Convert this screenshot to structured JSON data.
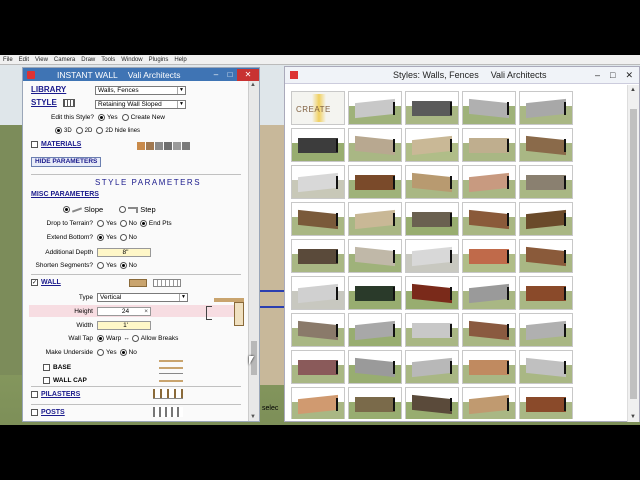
{
  "app_menu": [
    "File",
    "Edit",
    "View",
    "Camera",
    "Draw",
    "Tools",
    "Window",
    "Plugins",
    "Help"
  ],
  "scene": {
    "select_text": "selec"
  },
  "instant_wall": {
    "title": "INSTANT WALL",
    "subtitle": "Vali Architects",
    "library_label": "LIBRARY",
    "library_value": "Walls, Fences",
    "style_label": "STYLE",
    "style_value": "Retaining Wall Sloped",
    "edit_style_label": "Edit this Style?",
    "yes": "Yes",
    "create_new": "Create New",
    "view_3d": "3D",
    "view_2d": "2D",
    "view_2d_hide": "2D hide lines",
    "materials_label": "MATERIALS",
    "hide_params_button": "HIDE PARAMETERS",
    "style_params_title": "STYLE PARAMETERS",
    "misc_params_label": "MISC PARAMETERS",
    "slope": "Slope",
    "step": "Step",
    "drop_to_terrain_label": "Drop to Terrain?",
    "no": "No",
    "end_pts": "End Pts",
    "extend_bottom_label": "Extend Bottom?",
    "additional_depth_label": "Additional Depth",
    "additional_depth_value": "8\"",
    "shorten_segments_label": "Shorten Segments?",
    "wall_label": "WALL",
    "type_label": "Type",
    "type_value": "Vertical",
    "height_label": "Height",
    "height_value": "24",
    "width_label": "Width",
    "width_value": "1'",
    "wall_tap_label": "Wall Tap",
    "warp": "Warp",
    "allow_breaks": "Allow Breaks",
    "make_underside_label": "Make Underside",
    "base_label": "BASE",
    "wall_cap_label": "WALL CAP",
    "pilasters_label": "PILASTERS",
    "posts_label": "POSTS",
    "material_colors": [
      "#c98a4a",
      "#a07850",
      "#8a8a8a",
      "#6e6e6e",
      "#9a9a9a",
      "#7a7a7a"
    ]
  },
  "styles_panel": {
    "title": "Styles: Walls, Fences",
    "subtitle": "Vali Architects",
    "create_tile_text": "CREATE",
    "tiles": [
      {
        "wall": "#c8c8c8",
        "ground": "#9fb27a"
      },
      {
        "wall": "#5a5a5a",
        "ground": "#a9b784"
      },
      {
        "wall": "#b0b0b0",
        "ground": "#9fb27a"
      },
      {
        "wall": "#a8a8a8",
        "ground": "#a9b784"
      },
      {
        "wall": "#3c3c3c",
        "ground": "#98ad70"
      },
      {
        "wall": "#b8a890",
        "ground": "#a9b784"
      },
      {
        "wall": "#c9b896",
        "ground": "#b0bd88"
      },
      {
        "wall": "#bfae8e",
        "ground": "#a9b784"
      },
      {
        "wall": "#8a6a4a",
        "ground": "#a9b784"
      },
      {
        "wall": "#d8d8d8",
        "ground": "#c8c8b8"
      },
      {
        "wall": "#7a4a2a",
        "ground": "#9fb27a"
      },
      {
        "wall": "#b89a70",
        "ground": "#a9b784"
      },
      {
        "wall": "#c89a80",
        "ground": "#a9b784"
      },
      {
        "wall": "#8a8070",
        "ground": "#a9b784"
      },
      {
        "wall": "#7a5a3a",
        "ground": "#a9b784"
      },
      {
        "wall": "#c9b896",
        "ground": "#a9b784"
      },
      {
        "wall": "#6a6050",
        "ground": "#98ad70"
      },
      {
        "wall": "#8a5a3a",
        "ground": "#a9b784"
      },
      {
        "wall": "#6a4a2a",
        "ground": "#a9b784"
      },
      {
        "wall": "#5a4a3a",
        "ground": "#a9b784"
      },
      {
        "wall": "#c0b8a8",
        "ground": "#9fb27a"
      },
      {
        "wall": "#d8d8d8",
        "ground": "#c8c8c0"
      },
      {
        "wall": "#c06a4a",
        "ground": "#b0bd88"
      },
      {
        "wall": "#8a5a3a",
        "ground": "#a9b784"
      },
      {
        "wall": "#d0d0d0",
        "ground": "#c8c8c0"
      },
      {
        "wall": "#2a3a2a",
        "ground": "#98ad70"
      },
      {
        "wall": "#7a2a1a",
        "ground": "#98ad70"
      },
      {
        "wall": "#9a9a9a",
        "ground": "#a9b784"
      },
      {
        "wall": "#8a4a2a",
        "ground": "#a9b784"
      },
      {
        "wall": "#8a7a6a",
        "ground": "#a9b784"
      },
      {
        "wall": "#a8a8a8",
        "ground": "#98ad70"
      },
      {
        "wall": "#c8c8c8",
        "ground": "#a9b784"
      },
      {
        "wall": "#8a5a40",
        "ground": "#a9b784"
      },
      {
        "wall": "#b0b0b0",
        "ground": "#a9b784"
      },
      {
        "wall": "#8a5a5a",
        "ground": "#a9b784"
      },
      {
        "wall": "#9a9a9a",
        "ground": "#98ad70"
      },
      {
        "wall": "#b8b8b8",
        "ground": "#a9b784"
      },
      {
        "wall": "#c08a60",
        "ground": "#a9b784"
      },
      {
        "wall": "#c0c0c0",
        "ground": "#a9b784"
      },
      {
        "wall": "#d09a70",
        "ground": "#a9b784"
      },
      {
        "wall": "#7a6a4a",
        "ground": "#98ad70"
      },
      {
        "wall": "#5a4a3a",
        "ground": "#98ad70"
      },
      {
        "wall": "#c09a70",
        "ground": "#a9b784"
      },
      {
        "wall": "#8a4a2a",
        "ground": "#a9b784"
      },
      {
        "wall": "#a06a40",
        "ground": "#a9b784"
      },
      {
        "wall": "#c8c8c8",
        "ground": "#d8d8d8"
      },
      {
        "wall": "#7a6a5a",
        "ground": "#a9b784"
      },
      {
        "wall": "#c8b8a0",
        "ground": "#d8d8d8"
      },
      {
        "wall": "#8a5a3a",
        "ground": "#c8c8c0"
      },
      {
        "wall": "#6a4a2a",
        "ground": "#d8d8d8"
      }
    ]
  }
}
